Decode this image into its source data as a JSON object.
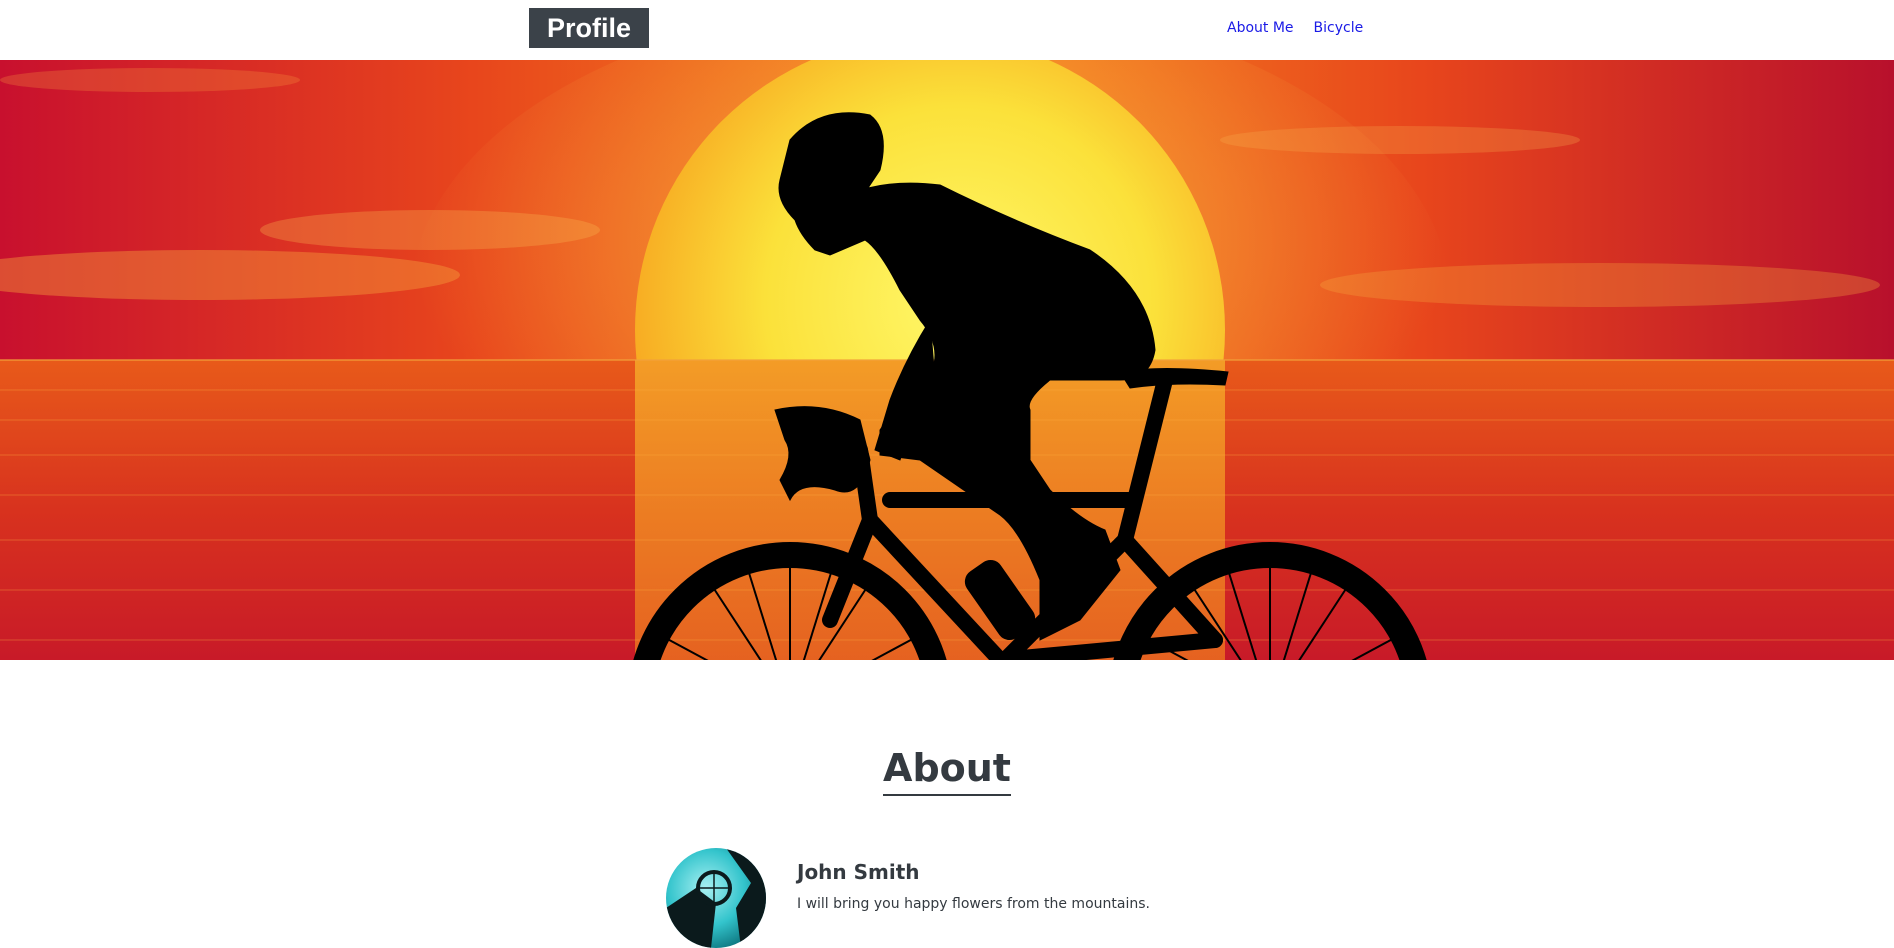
{
  "header": {
    "logo": "Profile",
    "nav": [
      {
        "label": "About Me"
      },
      {
        "label": "Bicycle"
      }
    ]
  },
  "hero": {
    "image": "cyclist-sunset-silhouette"
  },
  "about": {
    "title": "About",
    "name": "John Smith",
    "bio": "I will bring you happy flowers from the mountains."
  },
  "colors": {
    "logo_bg": "#3b4249",
    "link": "#1a1ae6",
    "heading": "#343a40",
    "sunset_orange": "#f07a1e",
    "sun_yellow": "#fbe64a"
  }
}
